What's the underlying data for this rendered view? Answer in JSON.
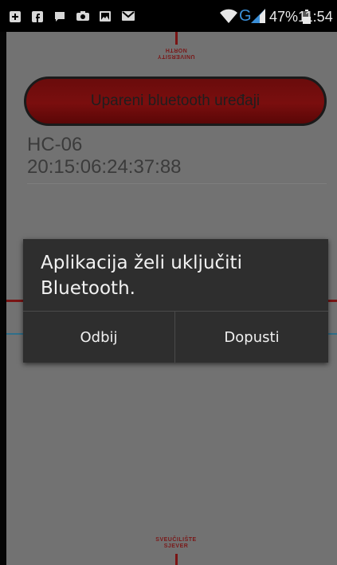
{
  "status_bar": {
    "battery_percent": "47%",
    "time": "11:54",
    "network_type": "G",
    "icons": [
      "plus-icon",
      "facebook-icon",
      "chat-icon",
      "camera-icon",
      "image-icon",
      "mail-icon",
      "wifi-icon",
      "signal-icon",
      "battery-icon"
    ]
  },
  "logos": {
    "top_line1": "UNIVERSITY",
    "top_line2": "NORTH",
    "bottom_line1": "SVEUČILIŠTE",
    "bottom_line2": "SJEVER"
  },
  "paired_button": {
    "label": "Upareni bluetooth uređaji"
  },
  "device": {
    "name": "HC-06",
    "address": "20:15:06:24:37:88"
  },
  "dialog": {
    "message": "Aplikacija želi uključiti Bluetooth.",
    "deny_label": "Odbij",
    "allow_label": "Dopusti"
  },
  "colors": {
    "accent_red": "#7a0e0e",
    "dialog_bg": "#2e2e2e",
    "network_blue": "#3b8fd8"
  }
}
